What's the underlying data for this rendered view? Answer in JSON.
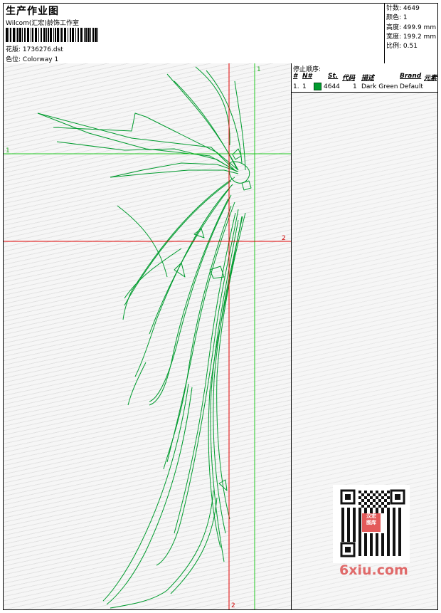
{
  "header": {
    "title": "生产作业图",
    "company": "Wilcom(汇宏)龄饰工作室",
    "design_label": "花版:",
    "design_file": "1736276.dst",
    "colorway_label": "色位:",
    "colorway": "Colorway 1"
  },
  "stats": {
    "stitches_label": "针数:",
    "stitches": "4649",
    "colors_label": "颜色:",
    "colors": "1",
    "height_label": "高度:",
    "height": "499.9 mm",
    "width_label": "宽度:",
    "width": "199.2 mm",
    "scale_label": "比例:",
    "scale": "0.51"
  },
  "stop_sequence": {
    "title": "停止顺序:",
    "columns": [
      "#",
      "N#",
      "St.",
      "代码",
      "描述",
      "Brand",
      "元素"
    ],
    "rows": [
      {
        "index": "1.",
        "needle": "1",
        "stitches": "4644",
        "code": "1",
        "description": "Dark Green",
        "brand": "Default",
        "color": "#009b2e"
      }
    ]
  },
  "guides": {
    "green_marker_top": "1",
    "green_marker_left": "1",
    "red_marker_right": "2",
    "red_marker_bottom": "2"
  },
  "qr": {
    "badge_line1": "汉宏",
    "badge_line2": "图库"
  },
  "watermark": "6xiu.com",
  "colors": {
    "thread": "#009b2e",
    "guide_green": "#22c822",
    "guide_red": "#e00000"
  }
}
